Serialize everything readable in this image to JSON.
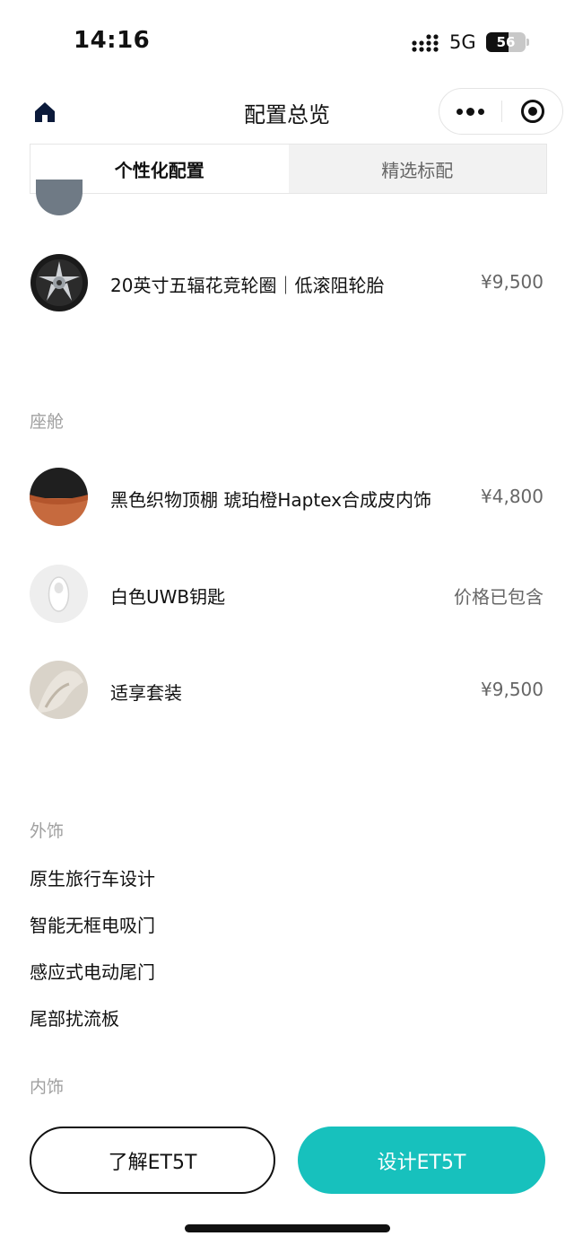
{
  "status_bar": {
    "time": "14:16",
    "network": "5G",
    "battery": "56",
    "battery_level": 0.56
  },
  "nav": {
    "title": "配置总览",
    "home_icon": "home-icon",
    "more_icon": "more-dots-icon",
    "close_icon": "target-close-icon"
  },
  "tabs": [
    {
      "label": "个性化配置",
      "active": true
    },
    {
      "label": "精选标配",
      "active": false
    }
  ],
  "wheels": {
    "label": "20英寸五辐花竞轮圈｜低滚阻轮胎",
    "price": "¥9,500"
  },
  "cockpit": {
    "title": "座舱",
    "items": [
      {
        "label": "黑色织物顶棚 琥珀橙Haptex合成皮内饰",
        "price": "¥4,800"
      },
      {
        "label": "白色UWB钥匙",
        "price": "价格已包含"
      },
      {
        "label": "适享套装",
        "price": "¥9,500"
      }
    ]
  },
  "exterior": {
    "title": "外饰",
    "items": [
      "原生旅行车设计",
      "智能无框电吸门",
      "感应式电动尾门",
      "尾部扰流板"
    ]
  },
  "interior": {
    "title": "内饰"
  },
  "buttons": {
    "learn": "了解ET5T",
    "design": "设计ET5T"
  },
  "colors": {
    "accent": "#17c1bd",
    "muted_text": "#a0a0a0"
  }
}
